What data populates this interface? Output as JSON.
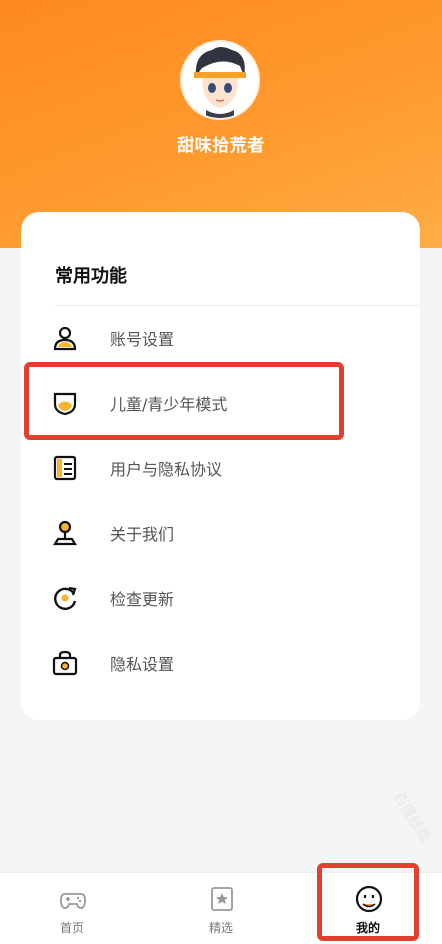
{
  "profile": {
    "username": "甜味拾荒者",
    "avatar_icon": "anime-boy-avatar"
  },
  "card": {
    "title": "常用功能",
    "items": [
      {
        "label": "账号设置",
        "icon": "person-icon"
      },
      {
        "label": "儿童/青少年模式",
        "icon": "shield-icon"
      },
      {
        "label": "用户与隐私协议",
        "icon": "document-icon"
      },
      {
        "label": "关于我们",
        "icon": "joystick-icon"
      },
      {
        "label": "检查更新",
        "icon": "refresh-icon"
      },
      {
        "label": "隐私设置",
        "icon": "lock-box-icon"
      }
    ]
  },
  "tabbar": {
    "tabs": [
      {
        "label": "首页",
        "icon": "gamepad-icon"
      },
      {
        "label": "精选",
        "icon": "star-box-icon"
      },
      {
        "label": "我的",
        "icon": "smile-icon",
        "active": true
      }
    ]
  },
  "watermark": "百度经验",
  "colors": {
    "accent": "#ff9a2e",
    "highlight": "#e0402e",
    "icon_yellow": "#f7b42c",
    "text_dark": "#111111",
    "text_muted": "#555555"
  }
}
